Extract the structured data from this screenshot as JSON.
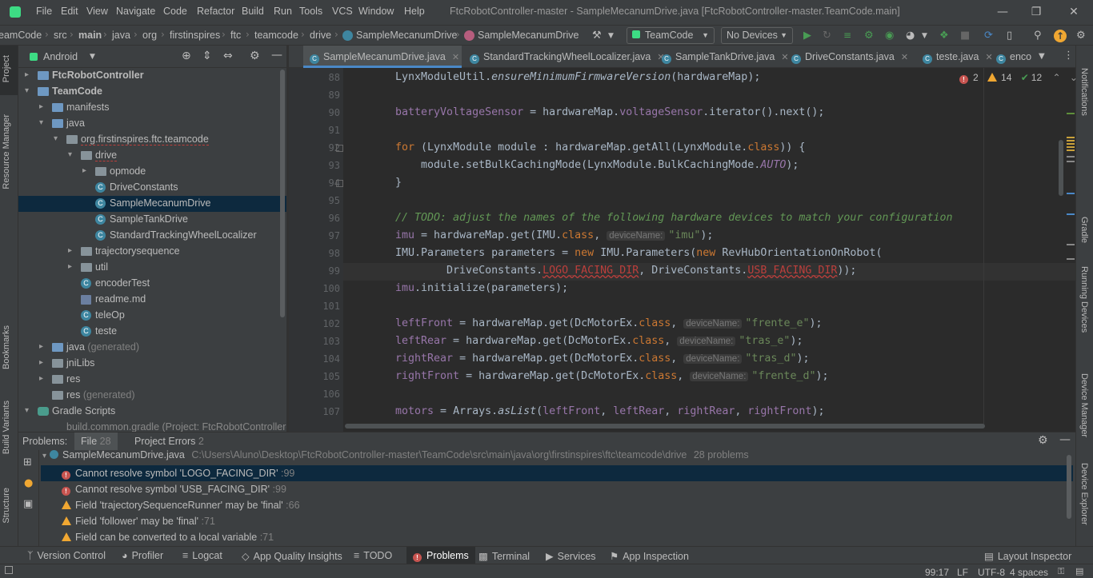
{
  "menu": [
    "File",
    "Edit",
    "View",
    "Navigate",
    "Code",
    "Refactor",
    "Build",
    "Run",
    "Tools",
    "VCS",
    "Window",
    "Help"
  ],
  "window_title": "FtcRobotController-master - SampleMecanumDrive.java [FtcRobotController-master.TeamCode.main]",
  "breadcrumbs": [
    "eamCode",
    "src",
    "main",
    "java",
    "org",
    "firstinspires",
    "ftc",
    "teamcode",
    "drive",
    "SampleMecanumDrive",
    "SampleMecanumDrive"
  ],
  "toolbar": {
    "run_config": "TeamCode",
    "device": "No Devices"
  },
  "project_panel": {
    "view": "Android",
    "tree": [
      {
        "label": "FtcRobotController",
        "bold": true
      },
      {
        "label": "TeamCode",
        "bold": true
      },
      {
        "label": "manifests"
      },
      {
        "label": "java"
      },
      {
        "label": "org.firstinspires.ftc.teamcode"
      },
      {
        "label": "drive"
      },
      {
        "label": "opmode"
      },
      {
        "label": "DriveConstants"
      },
      {
        "label": "SampleMecanumDrive"
      },
      {
        "label": "SampleTankDrive"
      },
      {
        "label": "StandardTrackingWheelLocalizer"
      },
      {
        "label": "trajectorysequence"
      },
      {
        "label": "util"
      },
      {
        "label": "encoderTest"
      },
      {
        "label": "readme.md"
      },
      {
        "label": "teleOp"
      },
      {
        "label": "teste"
      },
      {
        "label": "java",
        "suffix": "(generated)"
      },
      {
        "label": "jniLibs"
      },
      {
        "label": "res"
      },
      {
        "label": "res",
        "suffix": "(generated)"
      },
      {
        "label": "Gradle Scripts"
      },
      {
        "label": "build.common.gradle (Project: FtcRobotController-m"
      }
    ]
  },
  "editor_tabs": [
    "SampleMecanumDrive.java",
    "StandardTrackingWheelLocalizer.java",
    "SampleTankDrive.java",
    "DriveConstants.java",
    "teste.java",
    "enco"
  ],
  "inspections": {
    "errors": "2",
    "warnings": "14",
    "weak_warnings": "12"
  },
  "code": {
    "line_numbers": [
      "88",
      "89",
      "90",
      "91",
      "92",
      "93",
      "94",
      "95",
      "96",
      "97",
      "98",
      "99",
      "100",
      "101",
      "102",
      "103",
      "104",
      "105",
      "106",
      "107"
    ],
    "l88a": "LynxModuleUtil.",
    "l88b": "ensureMinimumFirmwareVersion",
    "l88c": "(hardwareMap);",
    "l90a": "batteryVoltageSensor",
    "l90b": " = hardwareMap.",
    "l90c": "voltageSensor",
    "l90d": ".iterator().next();",
    "l92a": "for",
    "l92b": " (LynxModule module : hardwareMap.getAll(LynxModule.",
    "l92c": "class",
    "l92d": ")) {",
    "l93a": "    module.setBulkCachingMode(LynxModule.BulkCachingMode.",
    "l93b": "AUTO",
    "l93c": ");",
    "l94": "}",
    "l96": "// TODO: adjust the names of the following hardware devices to match your configuration",
    "l97a": "imu",
    "l97b": " = hardwareMap.get(IMU.",
    "l97c": "class",
    "l97d": ", ",
    "hint": "deviceName:",
    "l97e": "\"imu\"",
    "l97f": ");",
    "l98a": "IMU.Parameters parameters = ",
    "l98b": "new",
    "l98c": " IMU.Parameters(",
    "l98d": "new",
    "l98e": " RevHubOrientationOnRobot(",
    "l99a": "        DriveConstants.",
    "l99b": "LOGO_FACING_DIR",
    "l99c": ", DriveConstants.",
    "l99d": "USB_FACING_DIR",
    "l99e": "));",
    "l100a": "imu",
    "l100b": ".initialize(parameters);",
    "l102a": "leftFront",
    "l102b": " = hardwareMap.get(DcMotorEx.",
    "l102c": "class",
    "l102d": ", ",
    "l102e": "\"frente_e\"",
    "l102f": ");",
    "l103a": "leftRear",
    "l103b": " = hardwareMap.get(DcMotorEx.",
    "l103c": "class",
    "l103d": ", ",
    "l103e": "\"tras_e\"",
    "l103f": ");",
    "l104a": "rightRear",
    "l104b": " = hardwareMap.get(DcMotorEx.",
    "l104c": "class",
    "l104d": ", ",
    "l104e": "\"tras_d\"",
    "l104f": ");",
    "l105a": "rightFront",
    "l105b": " = hardwareMap.get(DcMotorEx.",
    "l105c": "class",
    "l105d": ", ",
    "l105e": "\"frente_d\"",
    "l105f": ");",
    "l107a": "motors",
    "l107b": " = Arrays.",
    "l107c": "asList",
    "l107d": "(",
    "l107e": "leftFront",
    "l107f": ", ",
    "l107g": "leftRear",
    "l107h": ", ",
    "l107i": "rightRear",
    "l107j": ", ",
    "l107k": "rightFront",
    "l107l": ");"
  },
  "problems": {
    "title": "Problems:",
    "tab_file": "File",
    "tab_file_count": "28",
    "tab_project": "Project Errors",
    "tab_project_count": "2",
    "file_name": "SampleMecanumDrive.java",
    "file_path": "C:\\Users\\Aluno\\Desktop\\FtcRobotController-master\\TeamCode\\src\\main\\java\\org\\firstinspires\\ftc\\teamcode\\drive",
    "file_count": "28 problems",
    "items": [
      {
        "type": "error",
        "text": "Cannot resolve symbol 'LOGO_FACING_DIR'",
        "line": ":99"
      },
      {
        "type": "error",
        "text": "Cannot resolve symbol 'USB_FACING_DIR'",
        "line": ":99"
      },
      {
        "type": "warning",
        "text": "Field 'trajectorySequenceRunner' may be 'final'",
        "line": ":66"
      },
      {
        "type": "warning",
        "text": "Field 'follower' may be 'final'",
        "line": ":71"
      },
      {
        "type": "warning",
        "text": "Field can be converted to a local variable",
        "line": ":71"
      }
    ]
  },
  "bottom_tabs": [
    "Version Control",
    "Profiler",
    "Logcat",
    "App Quality Insights",
    "TODO",
    "Problems",
    "Terminal",
    "Services",
    "App Inspection"
  ],
  "layout_inspector": "Layout Inspector",
  "left_tool_tabs": [
    "Project",
    "Resource Manager",
    "Bookmarks",
    "Build Variants",
    "Structure"
  ],
  "right_tool_tabs": [
    "Notifications",
    "Gradle",
    "Running Devices",
    "Device Manager",
    "Device Explorer"
  ],
  "status": {
    "position": "99:17",
    "line_sep": "LF",
    "encoding": "UTF-8",
    "indent": "4 spaces"
  }
}
